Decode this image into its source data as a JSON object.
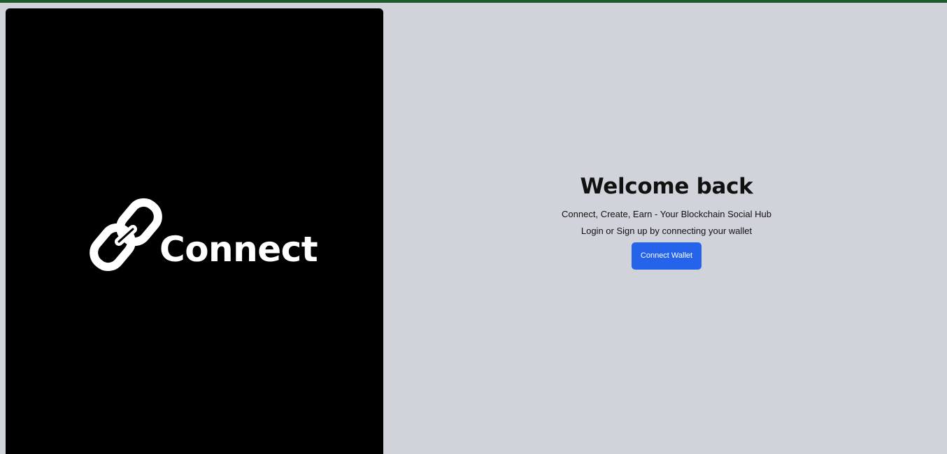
{
  "brand": {
    "name": "Connect",
    "logo_icon": "chain-link-icon",
    "panel_color": "#000000"
  },
  "auth": {
    "title": "Welcome back",
    "tagline": "Connect, Create, Earn - Your Blockchain Social Hub",
    "instruction": "Login or Sign up by connecting your wallet",
    "connect_button_label": "Connect Wallet"
  },
  "colors": {
    "top_bar": "#1f5a2d",
    "background": "#d1d3da",
    "button": "#2563eb"
  }
}
